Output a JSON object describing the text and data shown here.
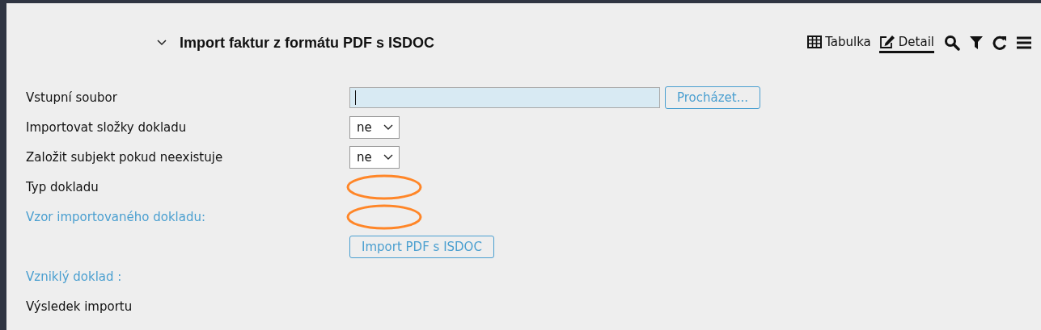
{
  "header": {
    "title": "Import faktur z formátu PDF s ISDOC"
  },
  "view_tabs": [
    {
      "label": "Tabulka",
      "selected": false
    },
    {
      "label": "Detail",
      "selected": true
    }
  ],
  "form_rows": [
    {
      "label": "Vstupní soubor",
      "link": false,
      "kind": "file",
      "button": "Procházet..."
    },
    {
      "label": "Importovat složky dokladu",
      "link": false,
      "kind": "select",
      "value": "ne"
    },
    {
      "label": "Založit subjekt pokud neexistuje",
      "link": false,
      "kind": "select",
      "value": "ne"
    },
    {
      "label": "Typ dokladu",
      "link": false,
      "kind": "empty",
      "annotated": true
    },
    {
      "label": "Vzor importovaného dokladu:",
      "link": true,
      "kind": "empty",
      "annotated": true
    },
    {
      "kind": "button",
      "button": "Import PDF s ISDOC"
    },
    {
      "label": "Vzniklý doklad :",
      "link": true,
      "kind": "empty",
      "annotated": false
    },
    {
      "label": "Výsledek importu",
      "link": false,
      "kind": "empty",
      "annotated": false
    }
  ]
}
